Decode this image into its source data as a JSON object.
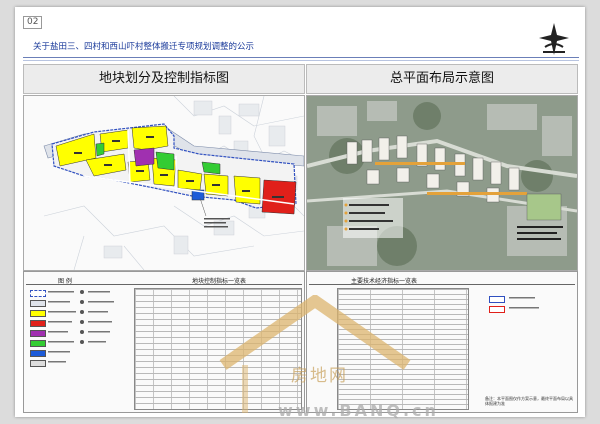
{
  "page": {
    "number": "02"
  },
  "document": {
    "title": "关于盐田三、四村和西山吓村整体搬迁专项规划调整的公示"
  },
  "panels": {
    "left_title": "地块划分及控制指标图",
    "right_title": "总平面布局示意图"
  },
  "lower_left": {
    "legend_title": "图   例",
    "table_title": "地块控制指标一览表"
  },
  "lower_right": {
    "table_title": "主要技术经济指标一览表",
    "note": "备注：本平面图仅作方案示意，最终平面布局以具体报建为准"
  },
  "watermark": {
    "text_cn": "房地网",
    "text_url": "www.BANQ.cn"
  },
  "colors": {
    "residential": "#ffff00",
    "commercial": "#e0201a",
    "school": "#a030b0",
    "green": "#33cc33",
    "public": "#1d5bd8",
    "road": "#f2f2f2",
    "boundary": "#3050c0"
  },
  "icons": [
    "logo-mark",
    "watermark-house"
  ]
}
